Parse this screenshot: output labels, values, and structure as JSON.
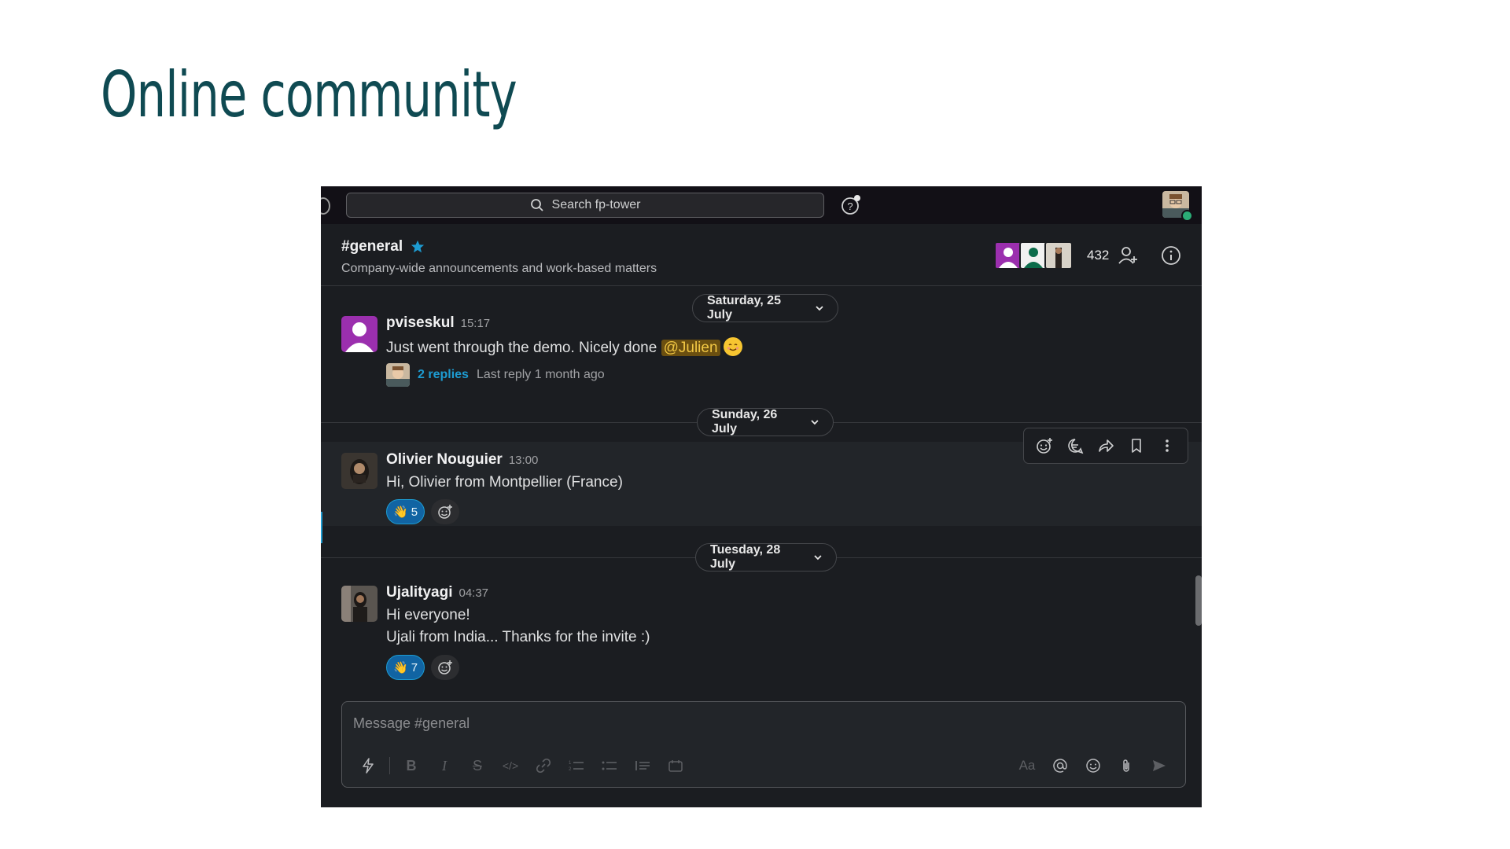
{
  "slide": {
    "title": "Online community"
  },
  "topbar": {
    "search_placeholder": "Search fp-tower"
  },
  "channel": {
    "name": "#general",
    "description": "Company-wide announcements and work-based matters",
    "member_count": "432"
  },
  "dates": {
    "d1": "Saturday, 25 July",
    "d2": "Sunday, 26 July",
    "d3": "Tuesday, 28 July"
  },
  "messages": [
    {
      "sender": "pviseskul",
      "time": "15:17",
      "text_before": "Just went through the demo. Nicely done ",
      "mention": "@Julien",
      "thread": {
        "replies": "2 replies",
        "last": "Last reply 1 month ago"
      }
    },
    {
      "sender": "Olivier Nouguier",
      "time": "13:00",
      "text": "Hi, Olivier from Montpellier (France)",
      "reaction": {
        "emoji": "👋",
        "count": "5"
      }
    },
    {
      "sender": "Ujalityagi",
      "time": "04:37",
      "line1": "Hi everyone!",
      "line2": "Ujali from India... Thanks for the invite :)",
      "reaction": {
        "emoji": "👋",
        "count": "7"
      }
    }
  ],
  "composer": {
    "placeholder": "Message #general",
    "text_style_label": "Aa"
  },
  "colors": {
    "accent_blue": "#1d9bd1",
    "presence_green": "#2bac76",
    "mention_bg": "#6b4f10",
    "mention_text": "#f2c744",
    "title_teal": "#0f4a52"
  }
}
